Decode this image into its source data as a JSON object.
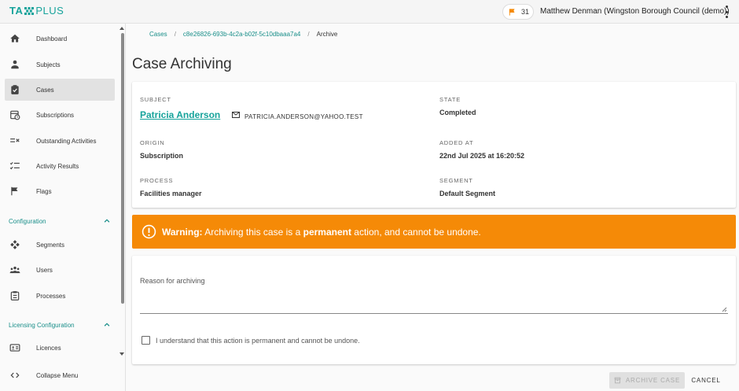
{
  "app": {
    "logo_a": "TA",
    "logo_b": "PLUS",
    "brand_color": "#16a39b"
  },
  "header": {
    "notification_count": "31",
    "user_name": "Matthew Denman (Wingston Borough Council (demo))"
  },
  "sidebar": {
    "items": [
      {
        "label": "Dashboard",
        "icon": "home-icon"
      },
      {
        "label": "Subjects",
        "icon": "person-icon"
      },
      {
        "label": "Cases",
        "icon": "clipboard-icon",
        "active": true
      },
      {
        "label": "Subscriptions",
        "icon": "calendar-clock-icon"
      },
      {
        "label": "Outstanding Activities",
        "icon": "checklist-x-icon"
      },
      {
        "label": "Activity Results",
        "icon": "list-check-icon"
      },
      {
        "label": "Flags",
        "icon": "flag-icon"
      }
    ],
    "config_heading": "Configuration",
    "config_items": [
      {
        "label": "Segments",
        "icon": "segments-icon"
      },
      {
        "label": "Users",
        "icon": "users-icon"
      },
      {
        "label": "Processes",
        "icon": "process-icon"
      }
    ],
    "licensing_heading": "Licensing Configuration",
    "licensing_items": [
      {
        "label": "Licences",
        "icon": "id-card-icon"
      }
    ],
    "collapse_label": "Collapse Menu"
  },
  "breadcrumb": {
    "cases": "Cases",
    "case_id": "c8e26826-693b-4c2a-b02f-5c10dbaaa7a4",
    "current": "Archive"
  },
  "page": {
    "title": "Case Archiving"
  },
  "details": {
    "subject_label": "Subject",
    "subject_name": "Patricia Anderson",
    "subject_email": "PATRICIA.ANDERSON@YAHOO.TEST",
    "state_label": "State",
    "state_value": "Completed",
    "origin_label": "Origin",
    "origin_value": "Subscription",
    "added_label": "Added at",
    "added_value": "22nd Jul 2025 at 16:20:52",
    "process_label": "Process",
    "process_value": "Facilities manager",
    "segment_label": "Segment",
    "segment_value": "Default Segment"
  },
  "warning": {
    "prefix": "Warning:",
    "text_1": " Archiving this case is a ",
    "emphasis": "permanent",
    "text_2": " action, and cannot be undone.",
    "color": "#f58a07"
  },
  "form": {
    "reason_label": "Reason for archiving",
    "reason_value": "",
    "confirm_label": "I understand that this action is permanent and cannot be undone.",
    "confirm_checked": false
  },
  "actions": {
    "archive_label": "ARCHIVE CASE",
    "cancel_label": "CANCEL"
  }
}
